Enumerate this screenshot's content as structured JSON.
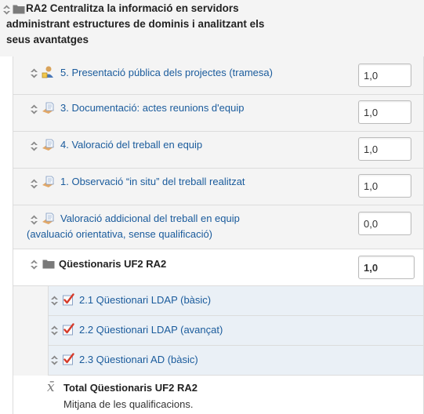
{
  "category": {
    "title": "RA2 Centralitza la informació en servidors administrant estructures de dominis i analitzant els seus avantatges"
  },
  "items": [
    {
      "label": "5. Presentació pública dels projectes (tramesa)",
      "value": "1,0",
      "icon": "assignment-icon"
    },
    {
      "label": "3. Documentació: actes reunions d'equip",
      "value": "1,0",
      "icon": "workshop-icon"
    },
    {
      "label": "4. Valoració del treball en equip",
      "value": "1,0",
      "icon": "workshop-icon"
    },
    {
      "label": "1. Observació “in situ” del treball realitzat",
      "value": "1,0",
      "icon": "workshop-icon"
    },
    {
      "label": "Valoració addicional del treball en equip (avaluació orientativa, sense qualificació)",
      "value": "0,0",
      "icon": "workshop-icon"
    }
  ],
  "subcategory": {
    "title": "Qüestionaris UF2 RA2",
    "value": "1,0",
    "items": [
      {
        "label": "2.1 Qüestionari LDAP (bàsic)",
        "icon": "quiz-icon"
      },
      {
        "label": "2.2 Qüestionari LDAP (avançat)",
        "icon": "quiz-icon"
      },
      {
        "label": "2.3 Qüestionari AD (bàsic)",
        "icon": "quiz-icon"
      }
    ],
    "total": {
      "symbol": "x̄",
      "label": "Total Qüestionaris UF2 RA2",
      "sublabel": "Mitjana de les qualificacions."
    }
  },
  "colors": {
    "link": "#1a5b9c",
    "row_gray": "#f4f4f4",
    "row_blue": "#eaf0f6"
  }
}
